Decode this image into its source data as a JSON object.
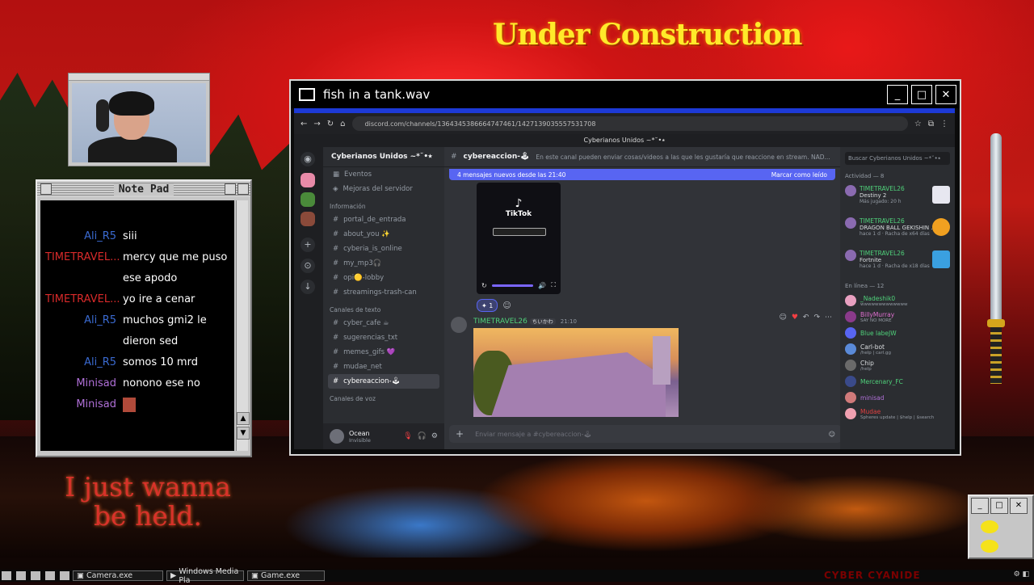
{
  "banner_text": "Under Construction",
  "lyric_text": "I just wanna be held.",
  "notepad": {
    "title": "Note Pad",
    "messages": [
      {
        "name": "Ali_R5",
        "color": "#3a6ad0",
        "text": "siii"
      },
      {
        "name": "TIMETRAVEL...",
        "color": "#d82a2a",
        "text": "mercy que me puso ese apodo"
      },
      {
        "name": "TIMETRAVEL...",
        "color": "#d82a2a",
        "text": "yo ire a cenar"
      },
      {
        "name": "Ali_R5",
        "color": "#3a6ad0",
        "text": "muchos gmi2 le dieron sed"
      },
      {
        "name": "Ali_R5",
        "color": "#3a6ad0",
        "text": "somos 10 mrd"
      },
      {
        "name": "Minisad",
        "color": "#b070d8",
        "text": "nonono ese no"
      },
      {
        "name": "Minisad",
        "color": "#b070d8",
        "text": ""
      }
    ]
  },
  "media_window": {
    "title": "fish in a tank.wav",
    "buttons": [
      "_",
      "□",
      "✕"
    ]
  },
  "browser": {
    "url": "discord.com/channels/1364345386664747461/1427139035557531708"
  },
  "discord": {
    "window_title": "Cyberianos Unidos ~*˘•⭑",
    "server_name": "Cyberianos Unidos ~*˘•⭑",
    "top_items": [
      "Eventos",
      "Mejoras del servidor"
    ],
    "categories": {
      "info": "Información",
      "text": "Canales de texto",
      "voice": "Canales de voz"
    },
    "info_channels": [
      "portal_de_entrada",
      "about_you ✨",
      "cyberia_is_online",
      "my_mp3🎧",
      "opi🟡-lobby",
      "streamings-trash-can"
    ],
    "text_channels": [
      "cyber_cafe ☕",
      "sugerencias_txt",
      "memes_gifs 💜",
      "mudae_net",
      "cybereaccion-🕹"
    ],
    "user": {
      "name": "Ocean",
      "status": "Invisible"
    },
    "channel_name": "cybereaccion-🕹",
    "topic": "En este canal pueden enviar cosas/videos a las que les gustaría que reaccione en stream. NAD...",
    "new_messages": "4 mensajes nuevos desde las 21:40",
    "mark_read": "Marcar como leído",
    "tiktok_label": "TikTok",
    "reaction_count": "1",
    "message_author": "TIMETRAVEL26",
    "message_tag": "ちいかわ",
    "message_time": "21:10",
    "input_placeholder": "Enviar mensaje a #cybereaccion-🕹",
    "search_placeholder": "Buscar Cyberianos Unidos ~*˘•⭑",
    "activity_header": "Actividad — 8",
    "activities": [
      {
        "name": "TIMETRAVEL26",
        "game": "Destiny 2",
        "sub": "Más jugado: 20 h"
      },
      {
        "name": "TIMETRAVEL26",
        "game": "DRAGON BALL GEKISHIN ...",
        "sub": "hace 1 d · Racha de x64 días"
      },
      {
        "name": "TIMETRAVEL26",
        "game": "Fortnite",
        "sub": "hace 1 d · Racha de x18 días"
      }
    ],
    "online_header": "En línea — 12",
    "online": [
      {
        "name": "_Nadeshik0",
        "sub": "wwwwwwwwwwwww",
        "color": "#4fd17a",
        "av": "#e8a0c0"
      },
      {
        "name": "BillyMurray",
        "sub": "SAY NO MORE",
        "color": "#e070d0",
        "av": "#8a3a8a"
      },
      {
        "name": "Blue labeJW",
        "sub": "",
        "color": "#4fd17a",
        "av": "#5865f2"
      },
      {
        "name": "Carl-bot",
        "sub": "/help | carl.gg",
        "color": "#dbdee1",
        "av": "#5a8ad8"
      },
      {
        "name": "Chip",
        "sub": "/help",
        "color": "#dbdee1",
        "av": "#6a6a6a"
      },
      {
        "name": "Mercenary_FC",
        "sub": "",
        "color": "#4fd17a",
        "av": "#3a4a8a"
      },
      {
        "name": "minisad",
        "sub": "",
        "color": "#b070d8",
        "av": "#d07a7a"
      },
      {
        "name": "Mudae",
        "sub": "Spheres update | $help | $search",
        "color": "#e04040",
        "av": "#f0a0b0"
      }
    ]
  },
  "taskbar": {
    "items": [
      "Camera.exe",
      "Windows Media Pla",
      "Game.exe"
    ],
    "brand": "CYBER CYANIDE"
  }
}
